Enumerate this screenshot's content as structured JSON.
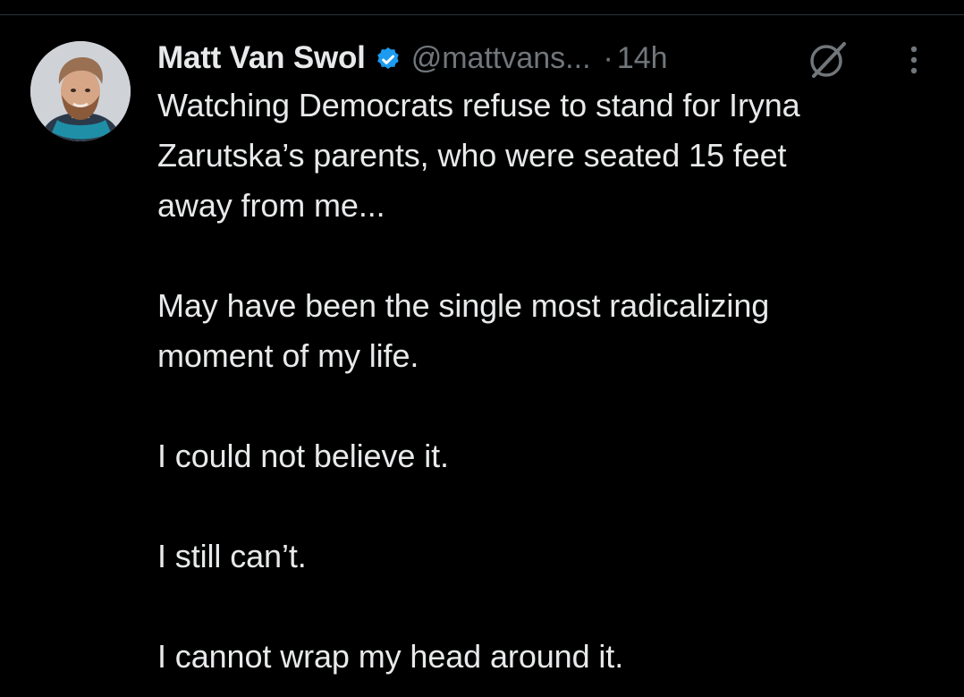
{
  "tweet": {
    "display_name": "Matt Van Swol",
    "handle": "@mattvans...",
    "separator": "·",
    "time": "14h",
    "text": "Watching Democrats refuse to stand for Iryna\nZarutska’s parents, who were seated 15 feet\naway from me...\n\nMay have been the single most radicalizing\nmoment of my life.\n\nI could not believe it.\n\nI still can’t.\n\nI cannot wrap my head around it."
  },
  "icons": {
    "verified": "verified-badge-icon",
    "grok": "grok-icon",
    "more": "more-options-icon"
  },
  "colors": {
    "background": "#000000",
    "primary_text": "#e7e9ea",
    "secondary_text": "#71767b",
    "verified_blue": "#1d9bf0",
    "divider": "#2f3336"
  }
}
